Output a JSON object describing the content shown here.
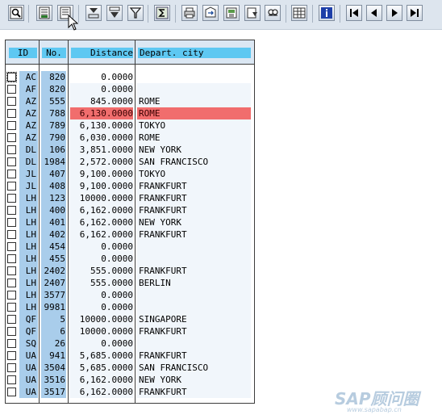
{
  "toolbar": {
    "buttons": [
      {
        "icon": "details-icon"
      },
      {
        "icon": "select-all-icon"
      },
      {
        "icon": "deselect-all-icon"
      },
      {
        "icon": "sort-ascending-icon"
      },
      {
        "icon": "sort-descending-icon"
      },
      {
        "icon": "filter-icon"
      },
      {
        "icon": "sum-icon"
      },
      {
        "icon": "print-icon"
      },
      {
        "icon": "export-icon"
      },
      {
        "icon": "save-layout-icon"
      },
      {
        "icon": "choose-layout-icon"
      },
      {
        "icon": "find-icon"
      },
      {
        "icon": "grid-view-icon"
      },
      {
        "icon": "information-icon"
      },
      {
        "icon": "first-page-icon"
      },
      {
        "icon": "previous-page-icon"
      },
      {
        "icon": "next-page-icon"
      },
      {
        "icon": "last-page-icon"
      }
    ]
  },
  "grid": {
    "headers": {
      "id": "ID",
      "no": "No.",
      "distance": "Distance",
      "city": "Depart. city"
    },
    "highlight_color": "#f16d6d",
    "rows": [
      {
        "id": "AC",
        "no": "820",
        "distance": "0.0000",
        "city": ""
      },
      {
        "id": "AF",
        "no": "820",
        "distance": "0.0000",
        "city": ""
      },
      {
        "id": "AZ",
        "no": "555",
        "distance": "845.0000",
        "city": "ROME"
      },
      {
        "id": "AZ",
        "no": "788",
        "distance": "6,130.0000",
        "city": "ROME",
        "highlighted": true
      },
      {
        "id": "AZ",
        "no": "789",
        "distance": "6,130.0000",
        "city": "TOKYO"
      },
      {
        "id": "AZ",
        "no": "790",
        "distance": "6,030.0000",
        "city": "ROME"
      },
      {
        "id": "DL",
        "no": "106",
        "distance": "3,851.0000",
        "city": "NEW YORK"
      },
      {
        "id": "DL",
        "no": "1984",
        "distance": "2,572.0000",
        "city": "SAN FRANCISCO"
      },
      {
        "id": "JL",
        "no": "407",
        "distance": "9,100.0000",
        "city": "TOKYO"
      },
      {
        "id": "JL",
        "no": "408",
        "distance": "9,100.0000",
        "city": "FRANKFURT"
      },
      {
        "id": "LH",
        "no": "123",
        "distance": "10000.0000",
        "city": "FRANKFURT"
      },
      {
        "id": "LH",
        "no": "400",
        "distance": "6,162.0000",
        "city": "FRANKFURT"
      },
      {
        "id": "LH",
        "no": "401",
        "distance": "6,162.0000",
        "city": "NEW YORK"
      },
      {
        "id": "LH",
        "no": "402",
        "distance": "6,162.0000",
        "city": "FRANKFURT"
      },
      {
        "id": "LH",
        "no": "454",
        "distance": "0.0000",
        "city": ""
      },
      {
        "id": "LH",
        "no": "455",
        "distance": "0.0000",
        "city": ""
      },
      {
        "id": "LH",
        "no": "2402",
        "distance": "555.0000",
        "city": "FRANKFURT"
      },
      {
        "id": "LH",
        "no": "2407",
        "distance": "555.0000",
        "city": "BERLIN"
      },
      {
        "id": "LH",
        "no": "3577",
        "distance": "0.0000",
        "city": ""
      },
      {
        "id": "LH",
        "no": "9981",
        "distance": "0.0000",
        "city": ""
      },
      {
        "id": "QF",
        "no": "5",
        "distance": "10000.0000",
        "city": "SINGAPORE"
      },
      {
        "id": "QF",
        "no": "6",
        "distance": "10000.0000",
        "city": "FRANKFURT"
      },
      {
        "id": "SQ",
        "no": "26",
        "distance": "0.0000",
        "city": ""
      },
      {
        "id": "UA",
        "no": "941",
        "distance": "5,685.0000",
        "city": "FRANKFURT"
      },
      {
        "id": "UA",
        "no": "3504",
        "distance": "5,685.0000",
        "city": "SAN FRANCISCO"
      },
      {
        "id": "UA",
        "no": "3516",
        "distance": "6,162.0000",
        "city": "NEW YORK"
      },
      {
        "id": "UA",
        "no": "3517",
        "distance": "6,162.0000",
        "city": "FRANKFURT"
      }
    ]
  },
  "watermark": {
    "logo": "SAP顾问圈",
    "url": "www.sapabap.cn"
  }
}
